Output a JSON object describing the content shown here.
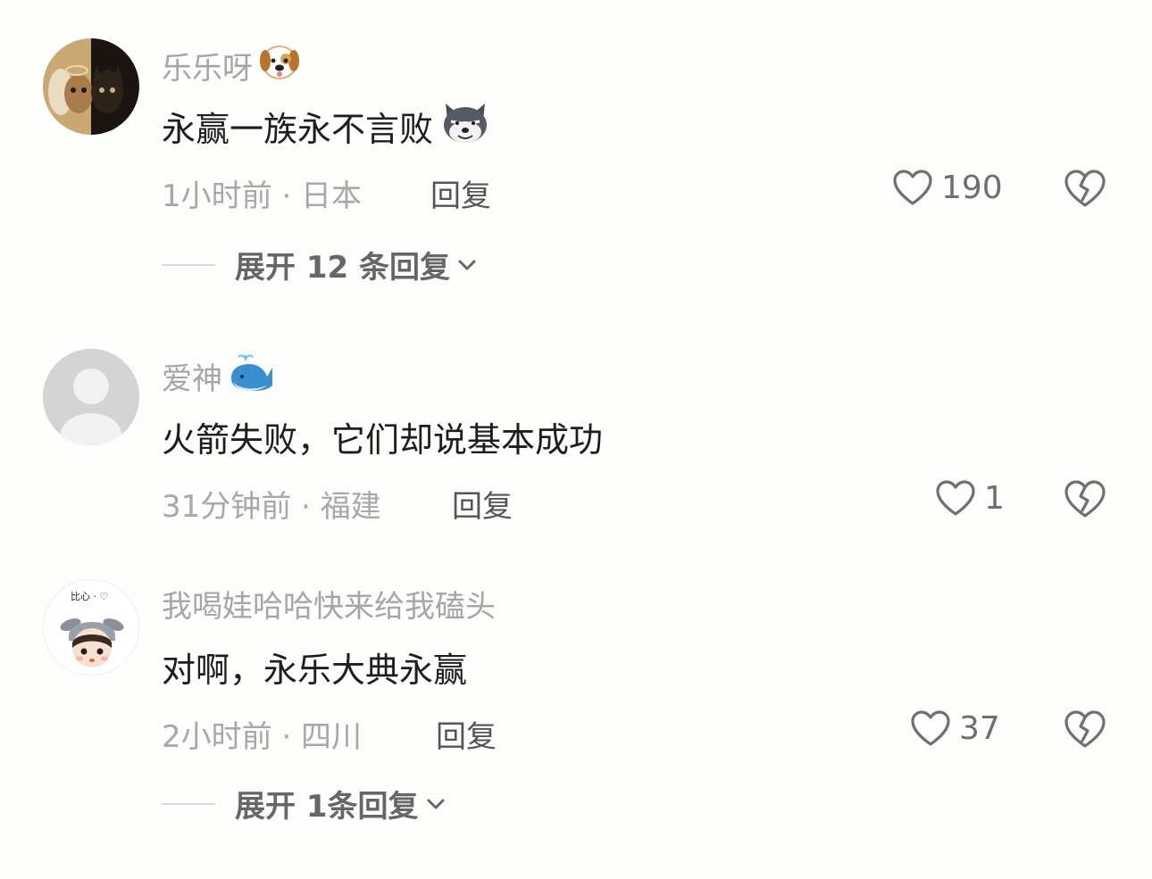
{
  "comments": [
    {
      "username": "乐乐呀",
      "username_emoji": "dog-face-emoji",
      "text": "永赢一族永不言败",
      "text_emoji": "wolf-face-emoji",
      "time": "1小时前 · 日本",
      "reply": "回复",
      "likes": "190",
      "avatar": "dog-photo-avatar"
    },
    {
      "username": "爱神",
      "username_emoji": "whale-emoji",
      "text": "火箭失败，它们却说基本成功",
      "time": "31分钟前 · 福建",
      "reply": "回复",
      "likes": "1",
      "avatar": "default-gray-avatar"
    },
    {
      "username": "我喝娃哈哈快来给我磕头",
      "text": "对啊，永乐大典永赢",
      "time": "2小时前 · 四川",
      "reply": "回复",
      "likes": "37",
      "avatar": "cartoon-girl-avatar",
      "avatar_text": "比心 · ♡"
    }
  ],
  "expand_replies": [
    {
      "label": "展开 12 条回复"
    },
    {
      "label": "展开 1条回复"
    }
  ],
  "colors": {
    "background": "#fdfdfb",
    "username": "#a6a6a6",
    "text": "#1e1e1e",
    "meta": "#a8a8a8",
    "icon": "#707070"
  },
  "icons": {
    "like": "heart-outline-icon",
    "dislike": "broken-heart-icon",
    "expand": "chevron-down-icon"
  }
}
